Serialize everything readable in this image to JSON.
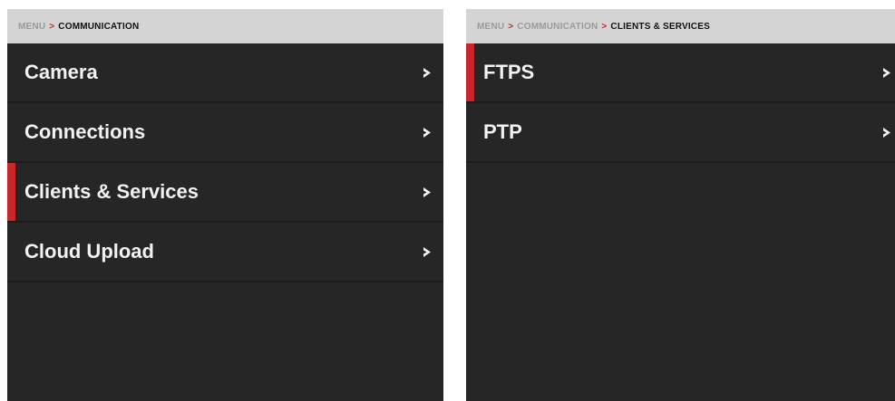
{
  "accent_color": "#c8262b",
  "left_panel": {
    "breadcrumb": {
      "items": [
        {
          "label": "MENU",
          "active": false
        },
        {
          "label": "COMMUNICATION",
          "active": true
        }
      ],
      "separator": ">"
    },
    "menu_items": [
      {
        "label": "Camera",
        "selected": false,
        "icon": "chevron-right-icon"
      },
      {
        "label": "Connections",
        "selected": false,
        "icon": "chevron-right-icon"
      },
      {
        "label": "Clients & Services",
        "selected": true,
        "icon": "chevron-right-icon"
      },
      {
        "label": "Cloud Upload",
        "selected": false,
        "icon": "chevron-right-icon"
      }
    ]
  },
  "right_panel": {
    "breadcrumb": {
      "items": [
        {
          "label": "MENU",
          "active": false
        },
        {
          "label": "COMMUNICATION",
          "active": false
        },
        {
          "label": "CLIENTS & SERVICES",
          "active": true
        }
      ],
      "separator": ">"
    },
    "menu_items": [
      {
        "label": "FTPS",
        "selected": true,
        "icon": "chevron-right-icon"
      },
      {
        "label": "PTP",
        "selected": false,
        "icon": "chevron-right-icon"
      }
    ]
  }
}
